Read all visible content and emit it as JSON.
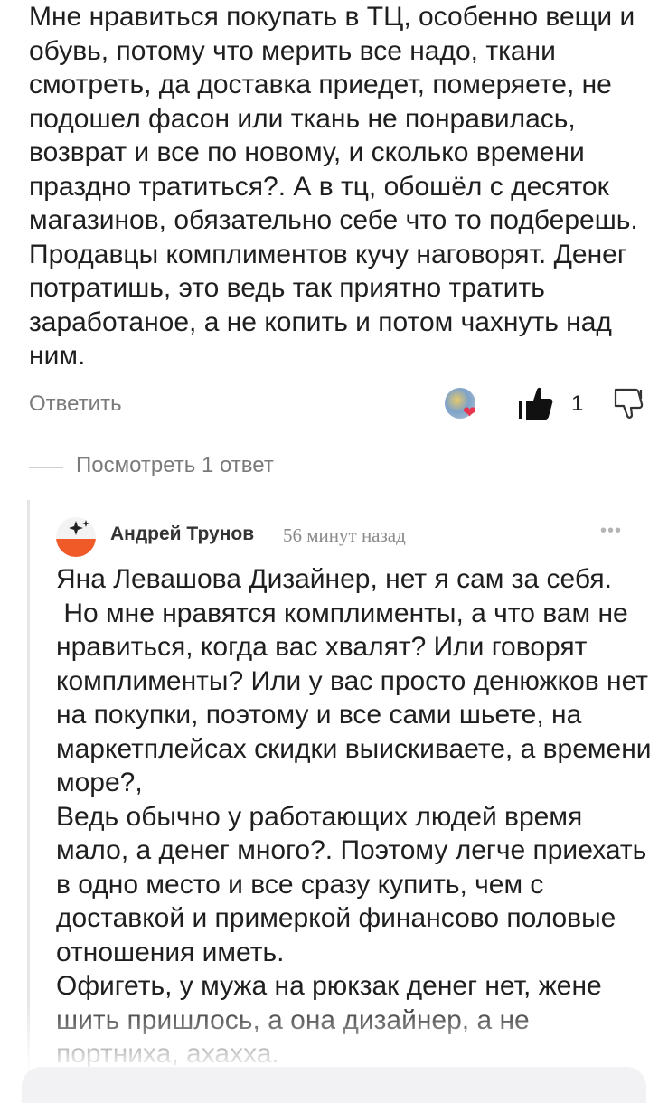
{
  "comment": {
    "text": "Мне нравиться покупать в ТЦ, особенно вещи и обувь, потому что мерить все надо, ткани смотреть, да доставка приедет, померяете, не подошел фасон или ткань не понравилась, возврат и все по новому, и сколько времени праздно тратиться?. А в тц, обошёл с десяток магазинов, обязательно себе что то подберешь. Продавцы комплиментов кучу наговорят. Денег потратишь, это ведь так приятно тратить заработаное, а не копить и потом чахнуть над ним.",
    "reply_label": "Ответить",
    "like_count": "1",
    "like_icon": "thumbs-up-icon",
    "dislike_icon": "thumbs-down-icon",
    "reaction_icon": "heart-icon"
  },
  "replies": {
    "show_label": "Посмотреть 1 ответ"
  },
  "reply": {
    "author": "Андрей Трунов",
    "time": "56 минут назад",
    "more_icon": "more-icon",
    "text": "Яна Левашова Дизайнер, нет я сам за себя.\n Но мне нравятся комплименты, а что вам не нравиться, когда вас хвалят? Или говорят комплименты? Или у вас просто денюжков нет на покупки, поэтому и все сами шьете, на маркетплейсах скидки выискиваете, а времени море?,\nВедь обычно у работающих людей время мало, а денег много?. Поэтому легче приехать в одно место и все сразу купить, чем с доставкой и примеркой финансово половые отношения иметь.\nОфигеть, у мужа на рюкзак денег нет, жене шить пришлось, а она дизайнер, а не портниха, ахахха."
  },
  "colors": {
    "text": "#1f1f1f",
    "muted": "#7a7a7a",
    "heart": "#e8344c",
    "avatar_orange": "#f05a28"
  }
}
